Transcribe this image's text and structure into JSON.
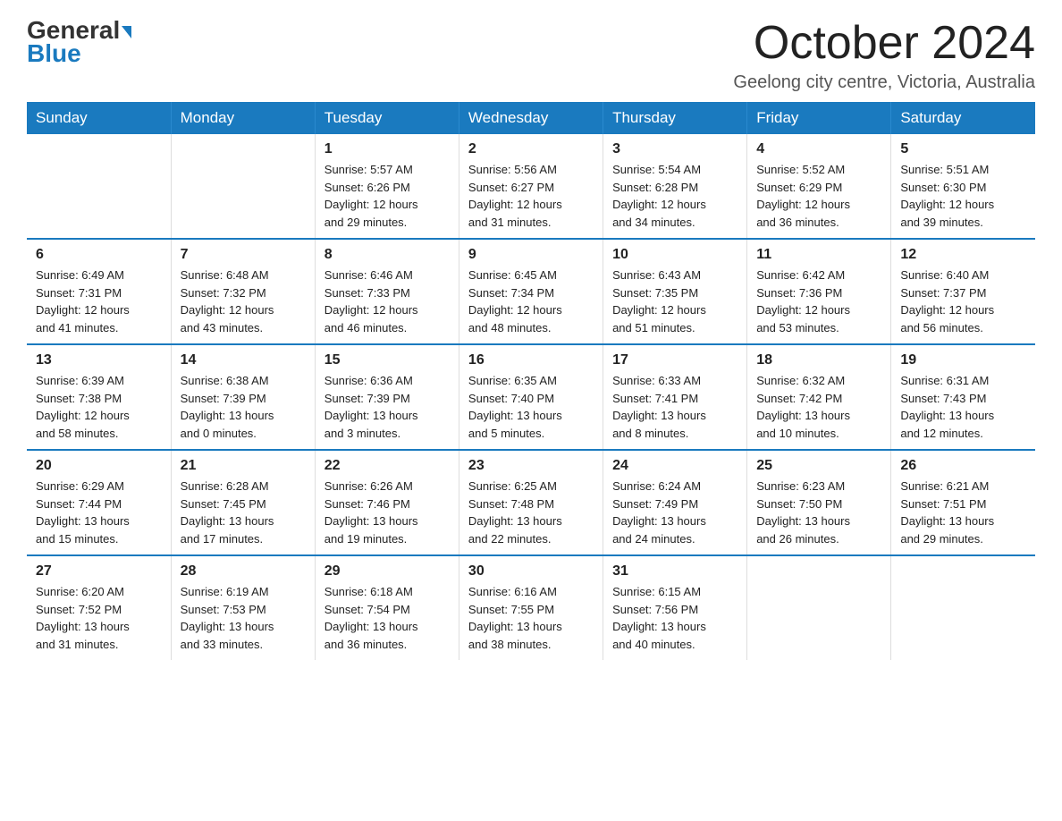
{
  "logo": {
    "general": "General",
    "blue": "Blue",
    "arrow": "▶"
  },
  "title": "October 2024",
  "location": "Geelong city centre, Victoria, Australia",
  "weekdays": [
    "Sunday",
    "Monday",
    "Tuesday",
    "Wednesday",
    "Thursday",
    "Friday",
    "Saturday"
  ],
  "weeks": [
    [
      {
        "day": "",
        "info": ""
      },
      {
        "day": "",
        "info": ""
      },
      {
        "day": "1",
        "info": "Sunrise: 5:57 AM\nSunset: 6:26 PM\nDaylight: 12 hours\nand 29 minutes."
      },
      {
        "day": "2",
        "info": "Sunrise: 5:56 AM\nSunset: 6:27 PM\nDaylight: 12 hours\nand 31 minutes."
      },
      {
        "day": "3",
        "info": "Sunrise: 5:54 AM\nSunset: 6:28 PM\nDaylight: 12 hours\nand 34 minutes."
      },
      {
        "day": "4",
        "info": "Sunrise: 5:52 AM\nSunset: 6:29 PM\nDaylight: 12 hours\nand 36 minutes."
      },
      {
        "day": "5",
        "info": "Sunrise: 5:51 AM\nSunset: 6:30 PM\nDaylight: 12 hours\nand 39 minutes."
      }
    ],
    [
      {
        "day": "6",
        "info": "Sunrise: 6:49 AM\nSunset: 7:31 PM\nDaylight: 12 hours\nand 41 minutes."
      },
      {
        "day": "7",
        "info": "Sunrise: 6:48 AM\nSunset: 7:32 PM\nDaylight: 12 hours\nand 43 minutes."
      },
      {
        "day": "8",
        "info": "Sunrise: 6:46 AM\nSunset: 7:33 PM\nDaylight: 12 hours\nand 46 minutes."
      },
      {
        "day": "9",
        "info": "Sunrise: 6:45 AM\nSunset: 7:34 PM\nDaylight: 12 hours\nand 48 minutes."
      },
      {
        "day": "10",
        "info": "Sunrise: 6:43 AM\nSunset: 7:35 PM\nDaylight: 12 hours\nand 51 minutes."
      },
      {
        "day": "11",
        "info": "Sunrise: 6:42 AM\nSunset: 7:36 PM\nDaylight: 12 hours\nand 53 minutes."
      },
      {
        "day": "12",
        "info": "Sunrise: 6:40 AM\nSunset: 7:37 PM\nDaylight: 12 hours\nand 56 minutes."
      }
    ],
    [
      {
        "day": "13",
        "info": "Sunrise: 6:39 AM\nSunset: 7:38 PM\nDaylight: 12 hours\nand 58 minutes."
      },
      {
        "day": "14",
        "info": "Sunrise: 6:38 AM\nSunset: 7:39 PM\nDaylight: 13 hours\nand 0 minutes."
      },
      {
        "day": "15",
        "info": "Sunrise: 6:36 AM\nSunset: 7:39 PM\nDaylight: 13 hours\nand 3 minutes."
      },
      {
        "day": "16",
        "info": "Sunrise: 6:35 AM\nSunset: 7:40 PM\nDaylight: 13 hours\nand 5 minutes."
      },
      {
        "day": "17",
        "info": "Sunrise: 6:33 AM\nSunset: 7:41 PM\nDaylight: 13 hours\nand 8 minutes."
      },
      {
        "day": "18",
        "info": "Sunrise: 6:32 AM\nSunset: 7:42 PM\nDaylight: 13 hours\nand 10 minutes."
      },
      {
        "day": "19",
        "info": "Sunrise: 6:31 AM\nSunset: 7:43 PM\nDaylight: 13 hours\nand 12 minutes."
      }
    ],
    [
      {
        "day": "20",
        "info": "Sunrise: 6:29 AM\nSunset: 7:44 PM\nDaylight: 13 hours\nand 15 minutes."
      },
      {
        "day": "21",
        "info": "Sunrise: 6:28 AM\nSunset: 7:45 PM\nDaylight: 13 hours\nand 17 minutes."
      },
      {
        "day": "22",
        "info": "Sunrise: 6:26 AM\nSunset: 7:46 PM\nDaylight: 13 hours\nand 19 minutes."
      },
      {
        "day": "23",
        "info": "Sunrise: 6:25 AM\nSunset: 7:48 PM\nDaylight: 13 hours\nand 22 minutes."
      },
      {
        "day": "24",
        "info": "Sunrise: 6:24 AM\nSunset: 7:49 PM\nDaylight: 13 hours\nand 24 minutes."
      },
      {
        "day": "25",
        "info": "Sunrise: 6:23 AM\nSunset: 7:50 PM\nDaylight: 13 hours\nand 26 minutes."
      },
      {
        "day": "26",
        "info": "Sunrise: 6:21 AM\nSunset: 7:51 PM\nDaylight: 13 hours\nand 29 minutes."
      }
    ],
    [
      {
        "day": "27",
        "info": "Sunrise: 6:20 AM\nSunset: 7:52 PM\nDaylight: 13 hours\nand 31 minutes."
      },
      {
        "day": "28",
        "info": "Sunrise: 6:19 AM\nSunset: 7:53 PM\nDaylight: 13 hours\nand 33 minutes."
      },
      {
        "day": "29",
        "info": "Sunrise: 6:18 AM\nSunset: 7:54 PM\nDaylight: 13 hours\nand 36 minutes."
      },
      {
        "day": "30",
        "info": "Sunrise: 6:16 AM\nSunset: 7:55 PM\nDaylight: 13 hours\nand 38 minutes."
      },
      {
        "day": "31",
        "info": "Sunrise: 6:15 AM\nSunset: 7:56 PM\nDaylight: 13 hours\nand 40 minutes."
      },
      {
        "day": "",
        "info": ""
      },
      {
        "day": "",
        "info": ""
      }
    ]
  ]
}
